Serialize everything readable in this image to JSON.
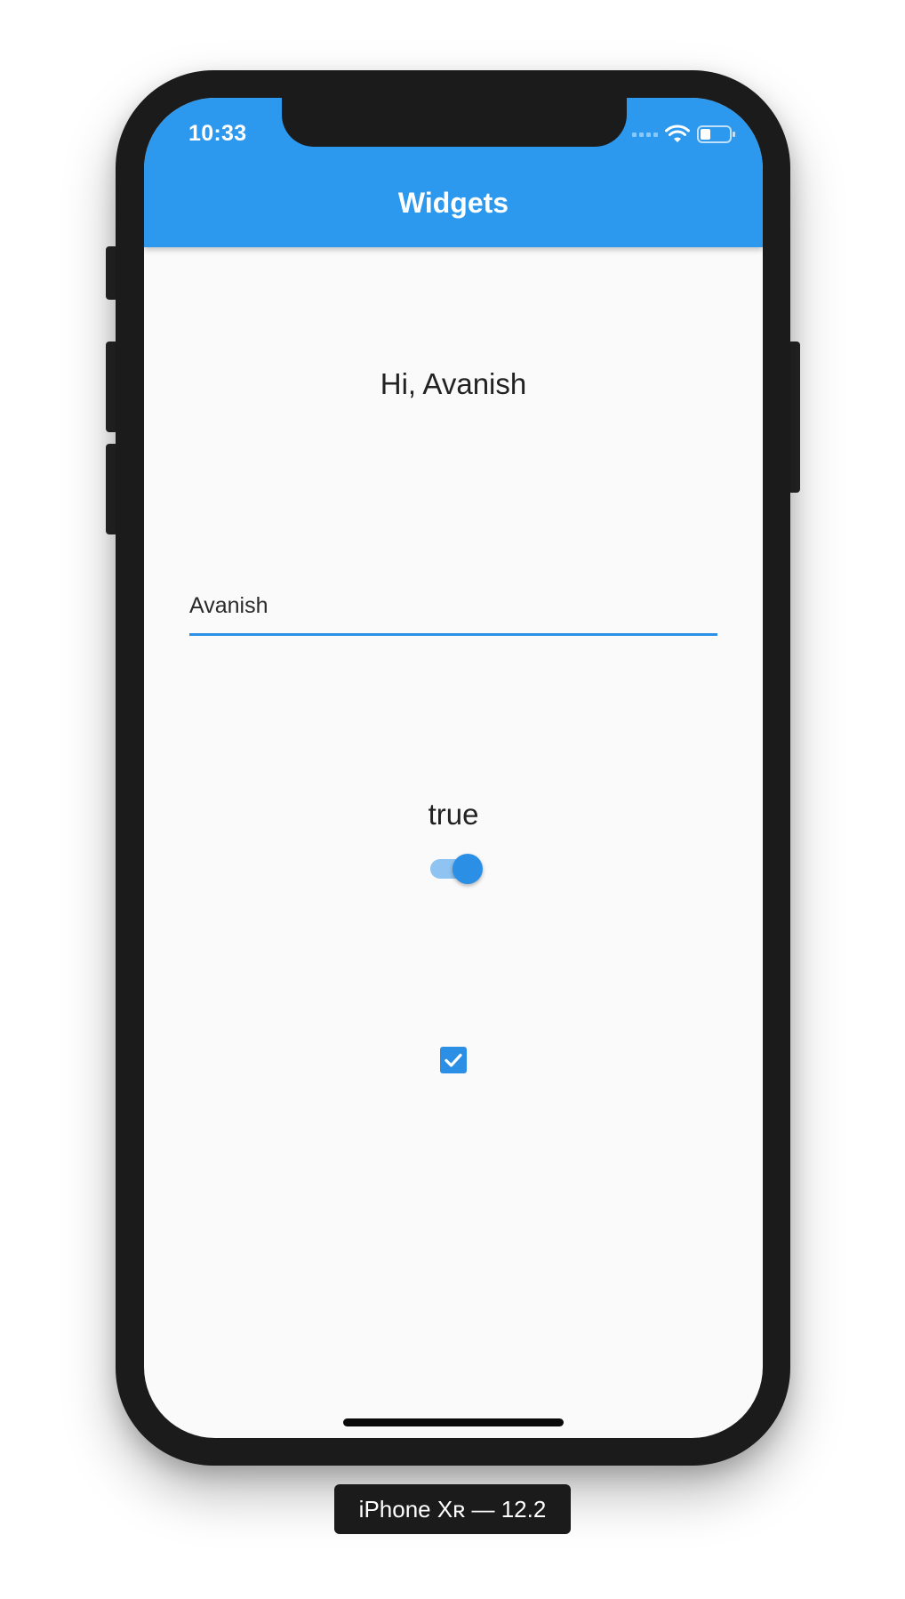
{
  "status_bar": {
    "time": "10:33",
    "icons": [
      "signal-icon",
      "wifi-icon",
      "battery-icon"
    ]
  },
  "app_bar": {
    "title": "Widgets",
    "color": "#2c98ee"
  },
  "content": {
    "greeting": "Hi, Avanish",
    "name_input_value": "Avanish",
    "switch_label": "true",
    "switch_on": true,
    "checkbox_checked": true,
    "accent_color": "#2c8fe6"
  },
  "device": {
    "label": "iPhone Xʀ — 12.2"
  }
}
